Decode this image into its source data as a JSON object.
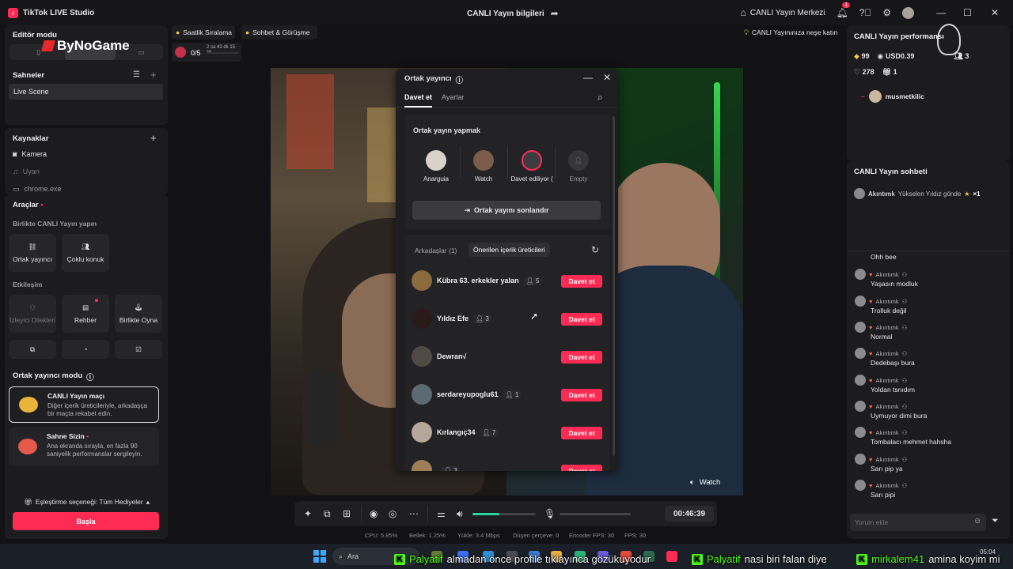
{
  "titlebar": {
    "app_name": "TikTok LIVE Studio",
    "center_title": "CANLI Yayın bilgileri",
    "live_center": "CANLI Yayın Merkezi",
    "notif_count": "1"
  },
  "left": {
    "editor_mode": "Editör modu",
    "overlay_logo": "ByNoGame",
    "scenes_title": "Sahneler",
    "scene_item": "Live Scene",
    "sources_title": "Kaynaklar",
    "sources": [
      "Kamera",
      "Uyarı",
      "chrome.exe"
    ],
    "tools_title": "Araçlar",
    "together_label": "Birlikte CANLI Yayın yapın",
    "tools_row1": [
      "Ortak yayıncı",
      "Çoklu konuk"
    ],
    "interaction_label": "Etkileşim",
    "tools_row2": [
      "İzleyici Dilekleri",
      "Rehber",
      "Birlikte Oyna"
    ],
    "cohost_mode_title": "Ortak yayıncı modu",
    "mode1_title": "CANLI Yayın maçı",
    "mode1_desc": "Diğer içerik üreticileriyle, arkadaşça bir maçta rekabet edin.",
    "mode2_title": "Sahne Sizin",
    "mode2_desc": "Ana ekranda sırayla, en fazla 90 saniyelik performanslar sergileyin.",
    "matching_option": "Eşleştirme seçeneği: Tüm Hediyeler",
    "start_button": "Başla"
  },
  "topstrip": {
    "hourly_ranking": "Saatlik Sıralama",
    "chat_call": "Sohbet & Görüşme",
    "join_prompt": "CANLI Yayınınıza neşe katın",
    "goal_progress": "0/5",
    "goal_timer": "2 sa 43 dk 15 sn"
  },
  "modal": {
    "title": "Ortak yayıncı",
    "tabs": [
      "Davet et",
      "Ayarlar"
    ],
    "section_title": "Ortak yayın yapmak",
    "slots": [
      "Anarguia",
      "Watch",
      "Davet ediliyor (",
      "Empty"
    ],
    "end_button": "Ortak yayını sonlandır",
    "list_tabs": [
      "Arkadaşlar (1)",
      "Önerilen içerik üreticileri"
    ],
    "users": [
      {
        "name": "Kübra 63. erkekler yalan",
        "count": "5"
      },
      {
        "name": "Yıldız Efe",
        "count": "3"
      },
      {
        "name": "Dewran√",
        "count": ""
      },
      {
        "name": "serdareyupoglu61",
        "count": "1"
      },
      {
        "name": "Kırlangıç34",
        "count": "7"
      },
      {
        "name": "",
        "count": "3"
      }
    ],
    "invite_label": "Davet et"
  },
  "stage": {
    "watch_label": "Watch"
  },
  "controls": {
    "timer": "00:46:39",
    "volume_level": 0.42
  },
  "statusbar": {
    "cpu": "CPU: 5.85%",
    "memory": "Bellek: 1.25%",
    "upload": "Yükle: 3.4 Mbps",
    "dropped": "Düşen çerçeve: 0",
    "encoder_fps": "Encoder FPS: 30",
    "fps": "FPS: 30"
  },
  "right": {
    "perf_title": "CANLI Yayın performansı",
    "diamonds": "99",
    "usd": "USD0.39",
    "viewers": "3",
    "likes": "278",
    "gifts": "1",
    "top_viewer": "musmetkilic",
    "chat_title": "CANLI Yayın sohbeti",
    "pinned_user": "Akıntımk",
    "pinned_text": "Yükselen Yıldız gönde",
    "pinned_count": "×1",
    "chat_username": "Akıntımk",
    "messages": [
      "Ohh bee",
      "Yaşasın modluk",
      "Trolluk değil",
      "Normal",
      "Dedebaşı bura",
      "Yoldan tsnıdım",
      "Uymuyor dimi bura",
      "Tombalacı mehmet hahsha",
      "Sarı pip ya",
      "Sarı pipi"
    ],
    "comment_placeholder": "Yorum ekle"
  },
  "taskbar": {
    "search": "Ara",
    "time": "05:04"
  },
  "kick_overlay": [
    {
      "user": "Palyatif",
      "text": "almadan önce profile tıklayınca gözükuyodur"
    },
    {
      "user": "Palyatif",
      "text": "nasi biri falan diye"
    },
    {
      "user": "mirkalem41",
      "text": "amina koyim mi"
    }
  ]
}
